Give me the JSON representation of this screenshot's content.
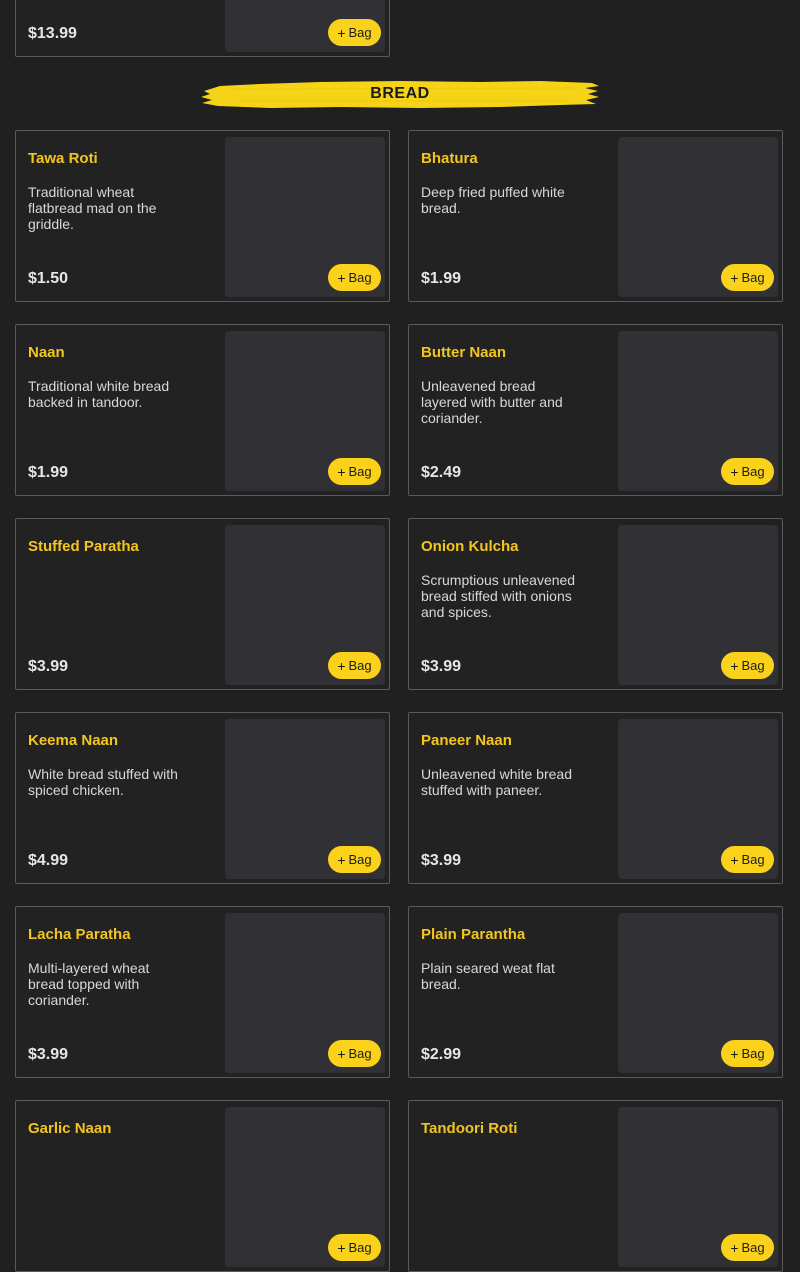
{
  "section_title": "BREAD",
  "bag_label": "Bag",
  "accent_color": "#f2c521",
  "partial_card": {
    "price": "$13.99"
  },
  "items": [
    {
      "name": "Tawa Roti",
      "description": "Traditional wheat flatbread mad on the griddle.",
      "price": "$1.50"
    },
    {
      "name": "Bhatura",
      "description": "Deep fried puffed white bread.",
      "price": "$1.99"
    },
    {
      "name": "Naan",
      "description": "Traditional white bread backed in tandoor.",
      "price": "$1.99"
    },
    {
      "name": "Butter Naan",
      "description": "Unleavened bread layered with butter and coriander.",
      "price": "$2.49"
    },
    {
      "name": "Stuffed Paratha",
      "description": "",
      "price": "$3.99"
    },
    {
      "name": "Onion Kulcha",
      "description": "Scrumptious unleavened bread stiffed with onions and spices.",
      "price": "$3.99"
    },
    {
      "name": "Keema Naan",
      "description": "White bread stuffed with spiced chicken.",
      "price": "$4.99"
    },
    {
      "name": "Paneer Naan",
      "description": "Unleavened white bread stuffed with paneer.",
      "price": "$3.99"
    },
    {
      "name": "Lacha Paratha",
      "description": "Multi-layered wheat bread topped with coriander.",
      "price": "$3.99"
    },
    {
      "name": "Plain Parantha",
      "description": "Plain seared weat flat bread.",
      "price": "$2.99"
    },
    {
      "name": "Garlic Naan",
      "description": "",
      "price": ""
    },
    {
      "name": "Tandoori Roti",
      "description": "",
      "price": ""
    }
  ]
}
